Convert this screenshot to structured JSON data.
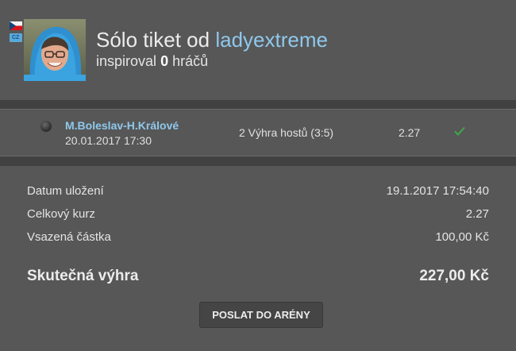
{
  "header": {
    "title_prefix": "Sólo tiket od",
    "author": "ladyextreme",
    "subtitle_prefix": "inspiroval",
    "inspired_count": "0",
    "subtitle_suffix": "hráčů",
    "badge_text": "CZ"
  },
  "bet": {
    "match": "M.Boleslav-H.Králové",
    "datetime": "20.01.2017 17:30",
    "pick": "2 Výhra hostů (3:5)",
    "odds": "2.27",
    "status_icon": "check-icon",
    "status_color": "#3ea84a"
  },
  "details": [
    {
      "label": "Datum uložení",
      "value": "19.1.2017 17:54:40"
    },
    {
      "label": "Celkový kurz",
      "value": "2.27"
    },
    {
      "label": "Vsazená částka",
      "value": "100,00 Kč"
    }
  ],
  "winnings": {
    "label": "Skutečná výhra",
    "value": "227,00 Kč"
  },
  "actions": {
    "send_label": "POSLAT DO ARÉNY"
  },
  "colors": {
    "background": "#575757",
    "divider": "#414141",
    "link": "#8fc8ec",
    "success": "#3ea84a"
  }
}
